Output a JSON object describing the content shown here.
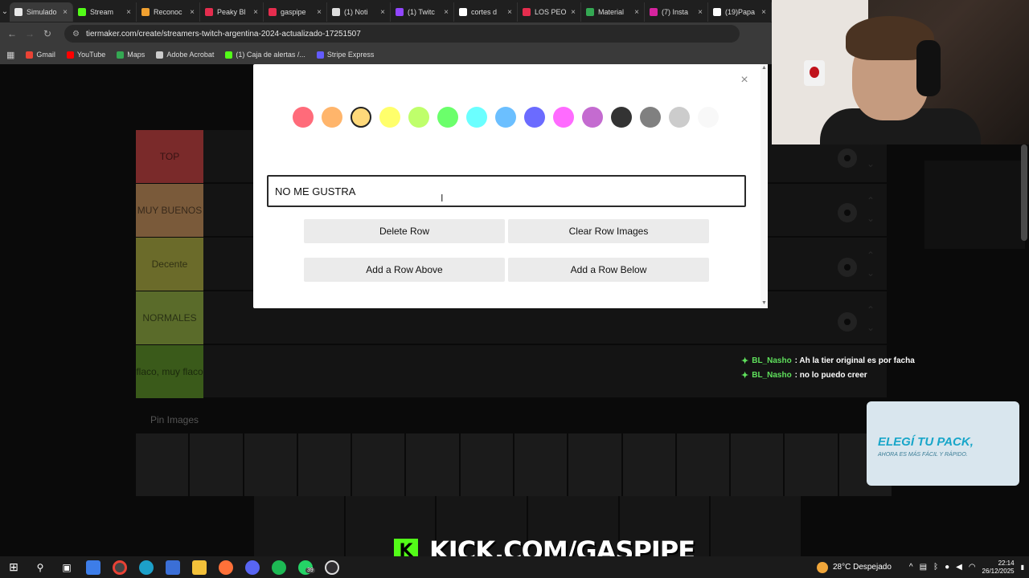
{
  "browser": {
    "tabs": [
      {
        "title": "Simulado",
        "color": "#e8e8e8",
        "active": true
      },
      {
        "title": "Stream",
        "color": "#53fc18"
      },
      {
        "title": "Reconoc",
        "color": "#f0a030"
      },
      {
        "title": "Peaky Bl",
        "color": "#e52d4e"
      },
      {
        "title": "gaspipe",
        "color": "#e52d4e"
      },
      {
        "title": "(1) Noti",
        "color": "#dddddd"
      },
      {
        "title": "(1) Twitc",
        "color": "#9146ff"
      },
      {
        "title": "cortes d",
        "color": "#ffffff"
      },
      {
        "title": "LOS PEO",
        "color": "#e52d4e"
      },
      {
        "title": "Material",
        "color": "#34a853"
      },
      {
        "title": "(7) Insta",
        "color": "#d6249f"
      },
      {
        "title": "(19)Papa",
        "color": "#ffffff"
      }
    ],
    "url": "tiermaker.com/create/streamers-twitch-argentina-2024-actualizado-17251507",
    "bookmarks": [
      {
        "label": "Gmail",
        "color": "#ea4335"
      },
      {
        "label": "YouTube",
        "color": "#ff0000"
      },
      {
        "label": "Maps",
        "color": "#34a853"
      },
      {
        "label": "Adobe Acrobat",
        "color": "#cccccc"
      },
      {
        "label": "(1) Caja de alertas /...",
        "color": "#53fc18"
      },
      {
        "label": "Stripe Express",
        "color": "#635bff"
      }
    ]
  },
  "tiers": [
    {
      "label": "TOP",
      "color": "#7a2a2a"
    },
    {
      "label": "MUY BUENOS",
      "color": "#7a5a3a"
    },
    {
      "label": "Decente",
      "color": "#6b6b2a"
    },
    {
      "label": "NORMALES",
      "color": "#5a6b2a"
    },
    {
      "label": "flaco, muy flaco",
      "color": "#3a5a1a"
    }
  ],
  "pin_images_label": "Pin Images",
  "modal": {
    "swatches": [
      "#ff6b7a",
      "#ffb56b",
      "#ffd97a",
      "#ffff6b",
      "#bfff6b",
      "#6bff6b",
      "#6bffff",
      "#6bbfff",
      "#6b6bff",
      "#ff6bff",
      "#c46bd0",
      "#333333",
      "#808080",
      "#cccccc",
      "#f8f8f8"
    ],
    "selected_swatch": 2,
    "input_value": "NO ME GUSTRA",
    "buttons": {
      "delete_row": "Delete Row",
      "clear_row_images": "Clear Row Images",
      "add_row_above": "Add a Row Above",
      "add_row_below": "Add a Row Below"
    },
    "close_glyph": "×"
  },
  "chat": [
    {
      "user": "BL_Nasho",
      "message": ": Ah la tier original es por facha"
    },
    {
      "user": "BL_Nasho",
      "message": ": no lo puedo creer"
    }
  ],
  "ad": {
    "headline": "ELEGÍ TU PACK,",
    "sub": "AHORA ES MÁS FÁCIL Y RÁPIDO."
  },
  "overlay": {
    "kick_logo": "K",
    "kick_text": "KICK.COM/GASPIPE"
  },
  "taskbar": {
    "whatsapp_badge": "39",
    "weather": "28°C  Despejado",
    "time": "22:14",
    "date": "26/12/2025"
  }
}
